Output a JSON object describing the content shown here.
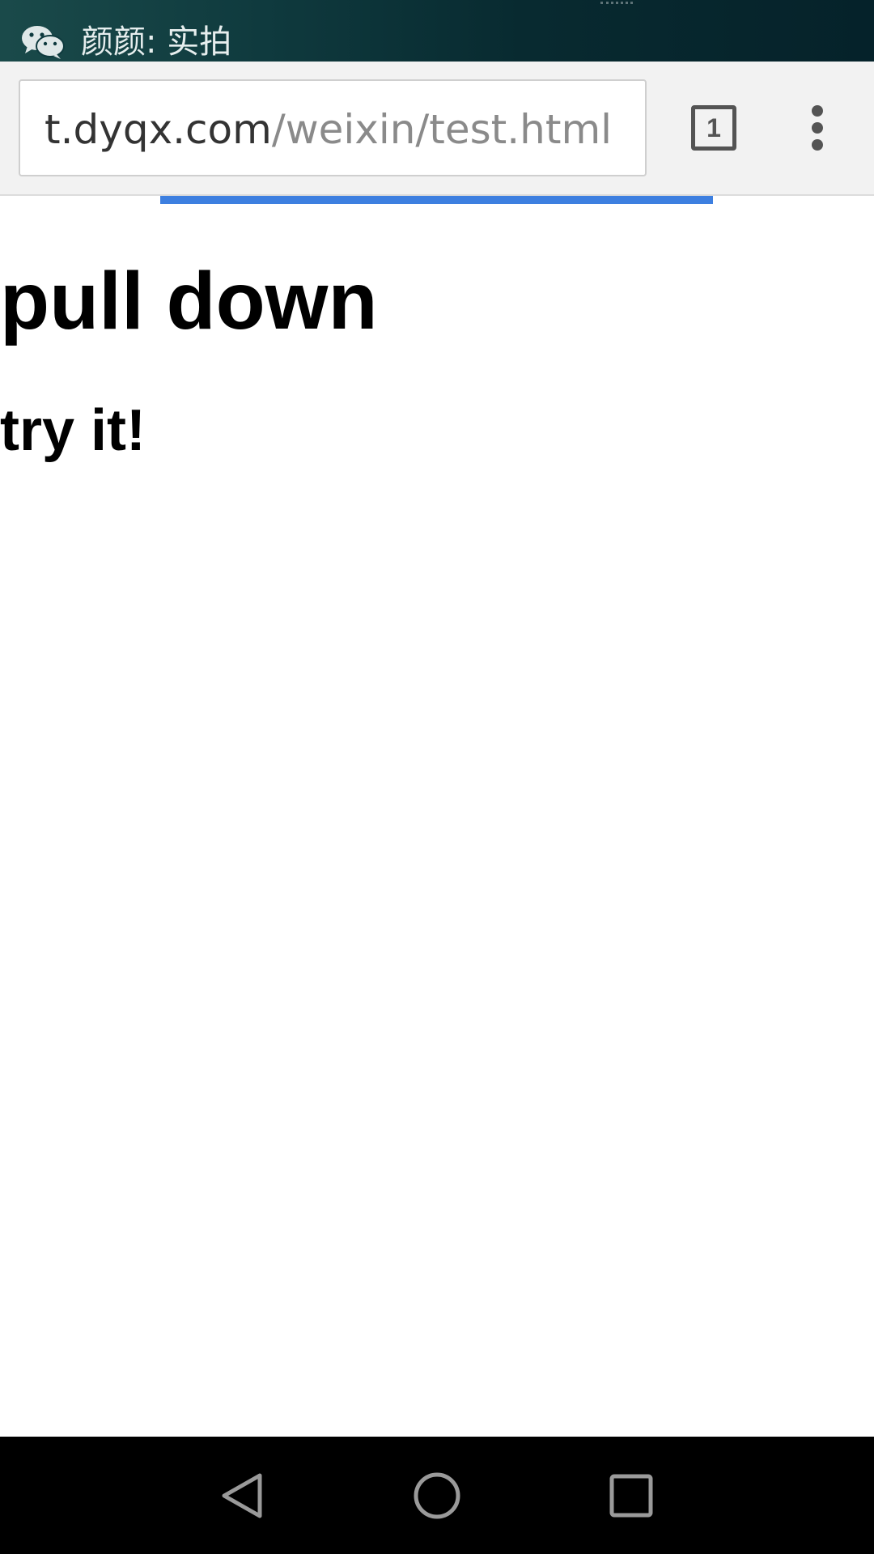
{
  "notification": {
    "app_icon": "wechat-icon",
    "text": "颜颜: 实拍"
  },
  "browser": {
    "url_domain": "t.dyqx.com",
    "url_path": "/weixin/test.html",
    "tab_count": "1",
    "menu_icon": "overflow-menu-icon",
    "load_progress": 0.63,
    "progress_color": "#3d7fe0"
  },
  "page": {
    "heading": "pull down",
    "subheading": "try it!"
  },
  "navigation": {
    "back_icon": "back-icon",
    "home_icon": "home-icon",
    "recents_icon": "recents-icon"
  }
}
